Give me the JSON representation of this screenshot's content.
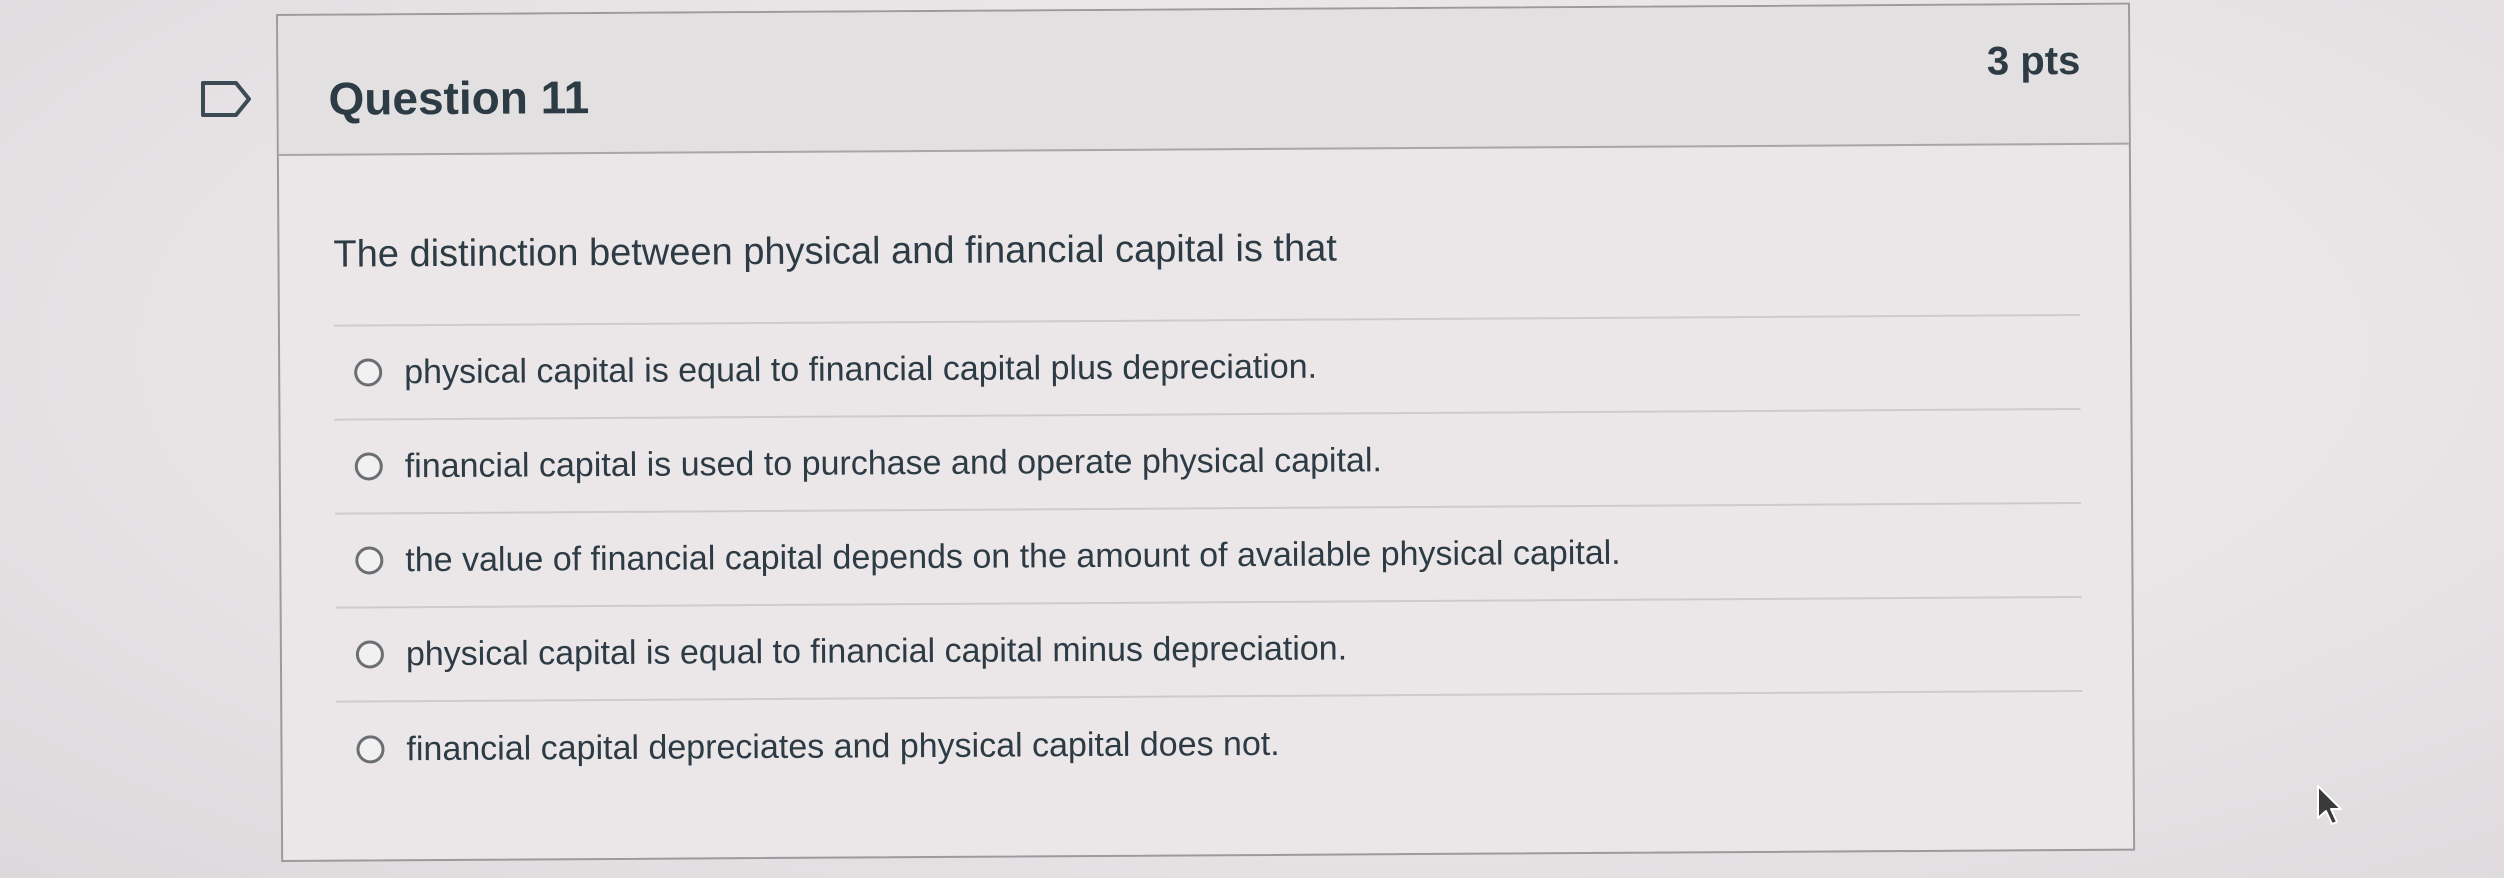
{
  "question": {
    "title": "Question 11",
    "points": "3 pts",
    "text": "The distinction between physical and financial capital is that",
    "answers": [
      {
        "label": "physical capital is equal to financial capital plus depreciation.",
        "selected": false
      },
      {
        "label": "financial capital is used to purchase and operate physical capital.",
        "selected": false
      },
      {
        "label": "the value of financial capital depends on the amount of available physical capital.",
        "selected": false
      },
      {
        "label": "physical capital is equal to financial capital minus depreciation.",
        "selected": false
      },
      {
        "label": "financial capital depreciates and physical capital does not.",
        "selected": false
      }
    ]
  },
  "icons": {
    "flag": "flag-icon",
    "cursor": "cursor-icon"
  },
  "colors": {
    "text": "#2d3b45",
    "border": "#9c9a9c",
    "header_bg": "#e3e0e2"
  }
}
